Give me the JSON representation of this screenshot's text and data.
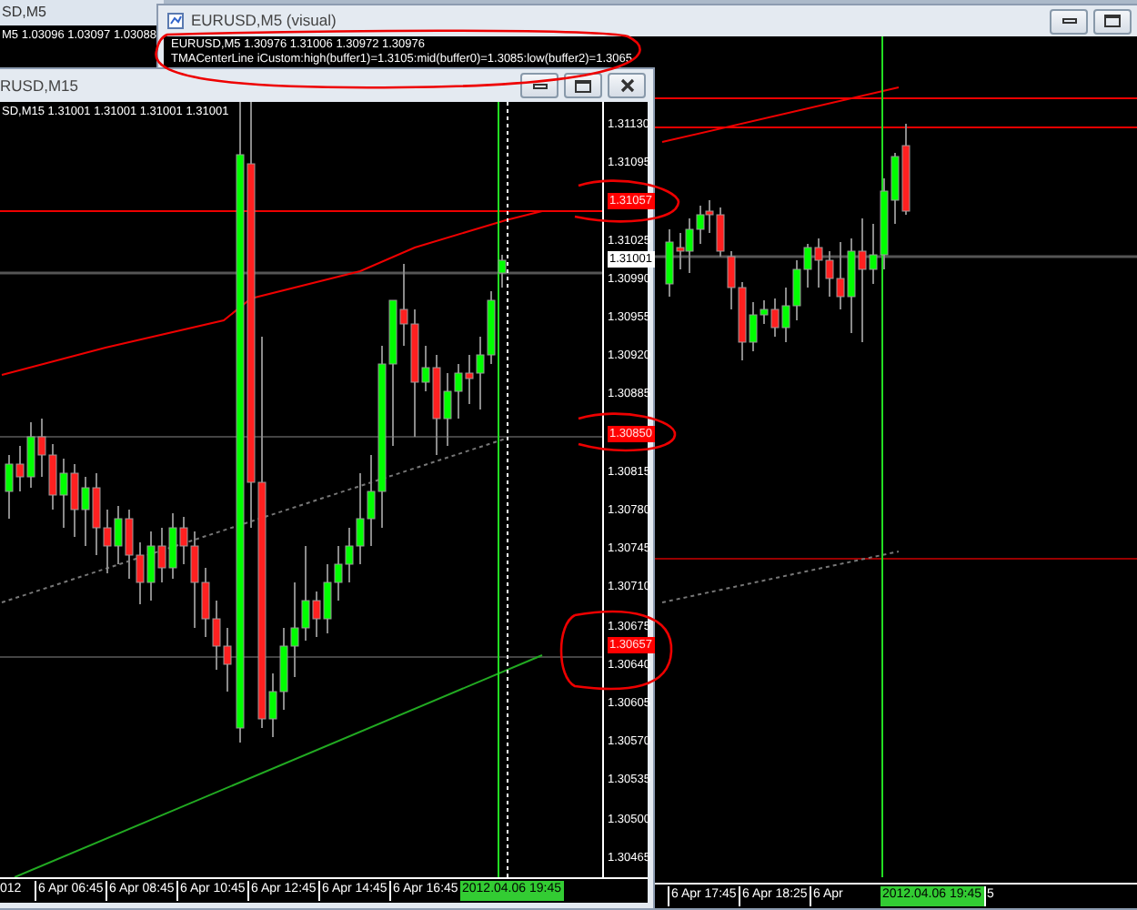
{
  "background_window": {
    "title": "SD,M5",
    "info": "M5  1.03096 1.03097 1.03088"
  },
  "visual_window": {
    "title": "EURUSD,M5 (visual)",
    "info_lines": [
      "EURUSD,M5  1.30976 1.31006 1.30972 1.30976",
      "TMACenterLine iCustom:high(buffer1)=1.3105:mid(buffer0)=1.3085:low(buffer2)=1.3065"
    ],
    "time_labels": [
      {
        "text": "6 Apr 17:45",
        "kind": "tick"
      },
      {
        "text": "6 Apr 18:25",
        "kind": "tick"
      },
      {
        "text": "6 Apr",
        "kind": "tick"
      },
      {
        "text": "2012.04.06 19:45",
        "kind": "cursor"
      },
      {
        "text": "5",
        "kind": "tick"
      }
    ]
  },
  "m15_window": {
    "title": "RUSD,M15",
    "info": "SD,M15  1.31001 1.31001 1.31001 1.31001",
    "price_labels": [
      {
        "text": "1.31130",
        "kind": "tick"
      },
      {
        "text": "1.31095",
        "kind": "tick"
      },
      {
        "text": "1.31057",
        "kind": "level_tag"
      },
      {
        "text": "1.31025",
        "kind": "tick"
      },
      {
        "text": "1.31001",
        "kind": "bid_tag"
      },
      {
        "text": "1.30990",
        "kind": "tick"
      },
      {
        "text": "1.30955",
        "kind": "tick"
      },
      {
        "text": "1.30920",
        "kind": "tick"
      },
      {
        "text": "1.30885",
        "kind": "tick"
      },
      {
        "text": "1.30850",
        "kind": "level_tag"
      },
      {
        "text": "1.30815",
        "kind": "tick"
      },
      {
        "text": "1.30780",
        "kind": "tick"
      },
      {
        "text": "1.30745",
        "kind": "tick"
      },
      {
        "text": "1.30710",
        "kind": "tick"
      },
      {
        "text": "1.30675",
        "kind": "tick"
      },
      {
        "text": "1.30657",
        "kind": "overlay_tag"
      },
      {
        "text": "1.30640",
        "kind": "tick"
      },
      {
        "text": "1.30605",
        "kind": "tick"
      },
      {
        "text": "1.30570",
        "kind": "tick"
      },
      {
        "text": "1.30535",
        "kind": "tick"
      },
      {
        "text": "1.30500",
        "kind": "tick"
      },
      {
        "text": "1.30465",
        "kind": "tick"
      }
    ],
    "time_labels": [
      {
        "text": "012",
        "kind": "edge"
      },
      {
        "text": "6 Apr 06:45",
        "kind": "tick"
      },
      {
        "text": "6 Apr 08:45",
        "kind": "tick"
      },
      {
        "text": "6 Apr 10:45",
        "kind": "tick"
      },
      {
        "text": "6 Apr 12:45",
        "kind": "tick"
      },
      {
        "text": "6 Apr 14:45",
        "kind": "tick"
      },
      {
        "text": "6 Apr 16:45",
        "kind": "tick"
      },
      {
        "text": "2012.04.06 19:45",
        "kind": "cursor"
      }
    ]
  }
}
